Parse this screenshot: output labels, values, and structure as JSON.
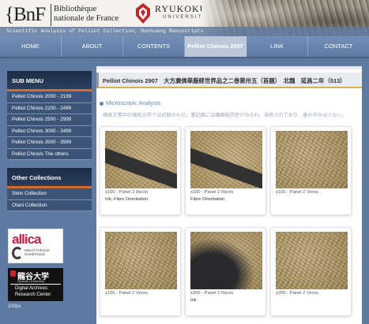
{
  "header": {
    "bnf_logo": "{BnF",
    "bnf_name_line1": "Bibliothèque",
    "bnf_name_line2": "nationale de France",
    "ryukoku_name": "RYUKOKU",
    "ryukoku_sub": "UNIVERSITY",
    "tagline": "Scientific Analysis of Pelliot Collection, Dunhuang Manuscripts"
  },
  "nav": {
    "items": [
      {
        "label": "HOME",
        "active": false
      },
      {
        "label": "ABOUT",
        "active": false
      },
      {
        "label": "CONTENTS",
        "active": false
      },
      {
        "label": "Pelliot Chinois 2907",
        "active": true
      },
      {
        "label": "LINK",
        "active": false
      },
      {
        "label": "CONTACT",
        "active": false
      }
    ]
  },
  "sidebar": {
    "submenu_title": "SUB MENU",
    "submenu": [
      "Pelliot Chinois 2000 - 2199",
      "Pelliot Chinois 2200 - 2499",
      "Pelliot Chinois 2500 - 2999",
      "Pelliot Chinois 3000 - 3499",
      "Pelliot Chinois 3500 - 3999",
      "Pelliot Chinois The others"
    ],
    "other_title": "Other Collections",
    "other": [
      "Stein Collection",
      "Otani Collection"
    ],
    "gallica_word": "allica",
    "gallica_sub1": "BIBLIOTHÈQUE",
    "gallica_sub2": "NUMÉRIQUE",
    "rdarc_jp": "龍谷大学",
    "rdarc_en": "Ryukoku University",
    "rdarc_t1": "Digital Archives",
    "rdarc_t2": "Research Center",
    "footnote": "220px"
  },
  "main": {
    "title": "Pelliot Chinois 2907　大方廣佛華厳經世界品之二巻第卅五（首題）　北魏　延昌二年（513）",
    "section_title": "Microscopic Analysis",
    "section_desc": "楮紙文書中の楮紙の中では初期のもの。書記面には繊維配向性がみられ、染色されており、墨の滲みは少ない。",
    "cards": [
      {
        "caption": "x100 - Panel 2 Recto",
        "note": "Ink, Fibre Orientation",
        "texture": "ink"
      },
      {
        "caption": "x100 - Panel 2 Recto",
        "note": "Fibre Orientation",
        "texture": "ink"
      },
      {
        "caption": "x100 - Panel 2 Verso",
        "note": "",
        "texture": "fibre"
      },
      {
        "caption": "x100 - Panel 2 Verso",
        "note": "",
        "texture": "fibre"
      },
      {
        "caption": "x200 - Panel 2 Recto",
        "note": "Ink",
        "texture": "inkdark"
      },
      {
        "caption": "x200 - Panel 2 Verso",
        "note": "",
        "texture": "fibre"
      }
    ]
  },
  "colors": {
    "background": "#5f7aa0",
    "sidebar_header": "#1c2c45",
    "sidebar_item": "#3b5478",
    "accent_orange": "#d96b2a",
    "title_underline": "#e8a94a",
    "section_blue": "#6b82a6",
    "ryukoku_red": "#c1272d"
  }
}
